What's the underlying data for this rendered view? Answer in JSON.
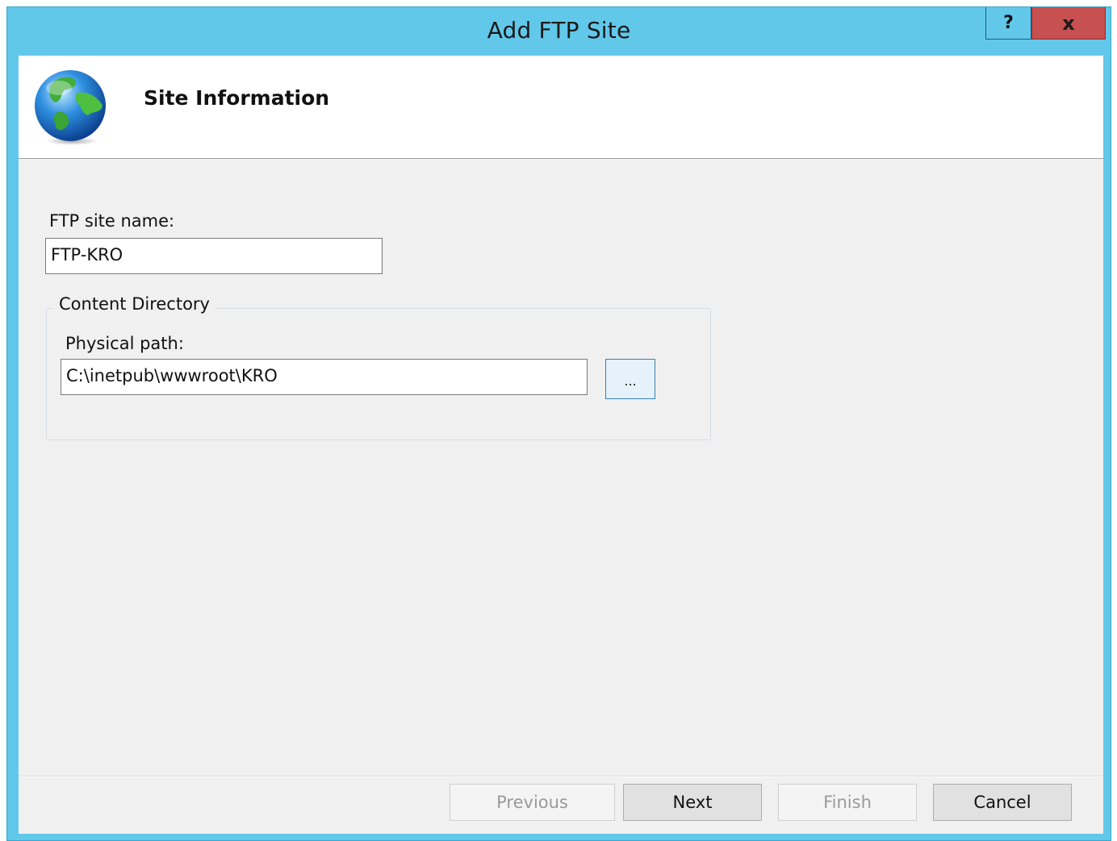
{
  "window": {
    "title": "Add FTP Site",
    "help_label": "?",
    "close_label": "x"
  },
  "header": {
    "title": "Site Information",
    "icon": "globe-icon"
  },
  "form": {
    "site_name_label": "FTP site name:",
    "site_name_value": "FTP-KRO",
    "content_directory_label": "Content Directory",
    "physical_path_label": "Physical path:",
    "physical_path_value": "C:\\inetpub\\wwwroot\\KRO",
    "browse_label": "..."
  },
  "buttons": {
    "previous": {
      "label": "Previous",
      "enabled": false
    },
    "next": {
      "label": "Next",
      "enabled": true
    },
    "finish": {
      "label": "Finish",
      "enabled": false
    },
    "cancel": {
      "label": "Cancel",
      "enabled": true
    }
  },
  "colors": {
    "titlebar": "#62c8ea",
    "close": "#c75050",
    "dialog_bg": "#f0f0f0"
  }
}
